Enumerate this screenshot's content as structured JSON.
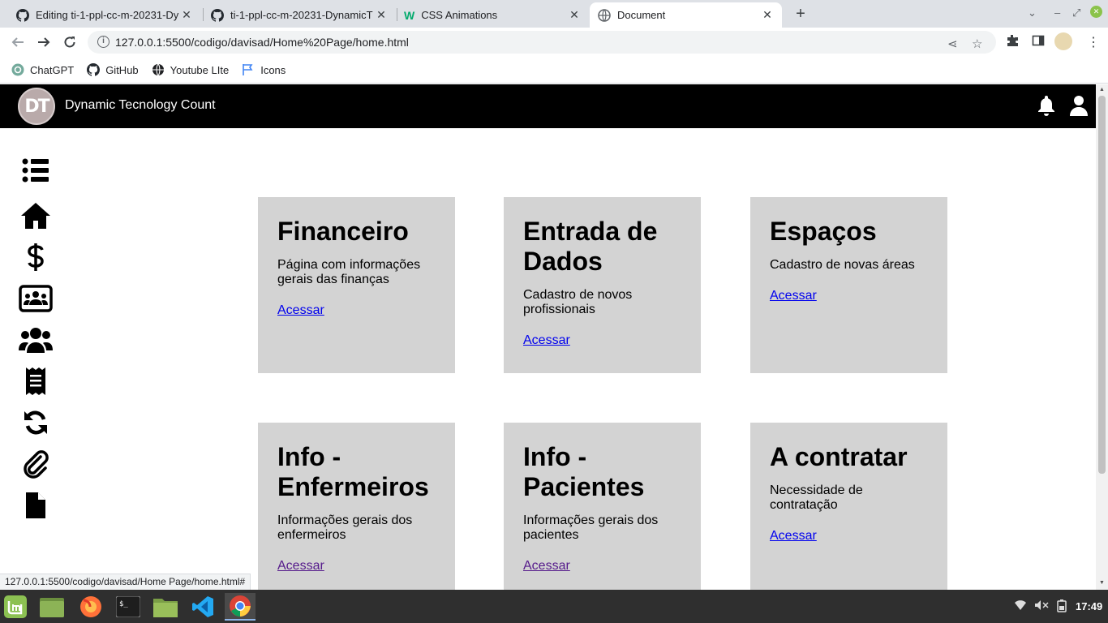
{
  "browser": {
    "tabs": [
      {
        "title": "Editing ti-1-ppl-cc-m-20231-Dy",
        "icon": "github-icon",
        "active": false
      },
      {
        "title": "ti-1-ppl-cc-m-20231-DynamicT",
        "icon": "github-icon",
        "active": false
      },
      {
        "title": "CSS Animations",
        "icon": "w3-icon",
        "active": false
      },
      {
        "title": "Document",
        "icon": "globe-icon",
        "active": true
      }
    ],
    "new_tab": "+",
    "url": "127.0.0.1:5500/codigo/davisad/Home%20Page/home.html",
    "bookmarks": [
      {
        "label": "ChatGPT",
        "icon": "chatgpt-icon"
      },
      {
        "label": "GitHub",
        "icon": "github-icon"
      },
      {
        "label": "Youtube LIte",
        "icon": "youtube-icon"
      },
      {
        "label": "Icons",
        "icon": "flag-icon"
      }
    ],
    "status_url": "127.0.0.1:5500/codigo/davisad/Home Page/home.html#"
  },
  "site": {
    "title": "Dynamic Tecnology Count",
    "logo_text": "DT",
    "sidebar": [
      {
        "name": "menu",
        "icon": "list-icon"
      },
      {
        "name": "home",
        "icon": "home-icon"
      },
      {
        "name": "finance",
        "icon": "dollar-icon"
      },
      {
        "name": "team",
        "icon": "users-rectangle-icon"
      },
      {
        "name": "people",
        "icon": "users-icon"
      },
      {
        "name": "receipt",
        "icon": "receipt-icon"
      },
      {
        "name": "sync",
        "icon": "sync-icon"
      },
      {
        "name": "attachments",
        "icon": "paperclip-icon"
      },
      {
        "name": "documents",
        "icon": "file-icon"
      }
    ],
    "cards": [
      {
        "title": "Financeiro",
        "description": "Página com informações gerais das finanças",
        "link": "Acessar"
      },
      {
        "title": "Entrada de Dados",
        "description": "Cadastro de novos profissionais",
        "link": "Acessar"
      },
      {
        "title": "Espaços",
        "description": "Cadastro de novas áreas",
        "link": "Acessar"
      },
      {
        "title": "Info - Enfermeiros",
        "description": "Informações gerais dos enfermeiros",
        "link": "Acessar"
      },
      {
        "title": "Info - Pacientes",
        "description": "Informações gerais dos pacientes",
        "link": "Acessar"
      },
      {
        "title": "A contratar",
        "description": "Necessidade de contratação",
        "link": "Acessar"
      }
    ]
  },
  "taskbar": {
    "apps": [
      "mint-menu-icon",
      "files-icon",
      "firefox-icon",
      "terminal-icon",
      "folder-icon",
      "vscode-icon",
      "chrome-icon"
    ],
    "clock": "17:49"
  },
  "colors": {
    "header_bg": "#000000",
    "card_bg": "#d3d3d3",
    "link": "#0000ee",
    "link_visited": "#551a8b",
    "tabbar_bg": "#dee1e6",
    "taskbar_bg": "#2f2f2f"
  }
}
